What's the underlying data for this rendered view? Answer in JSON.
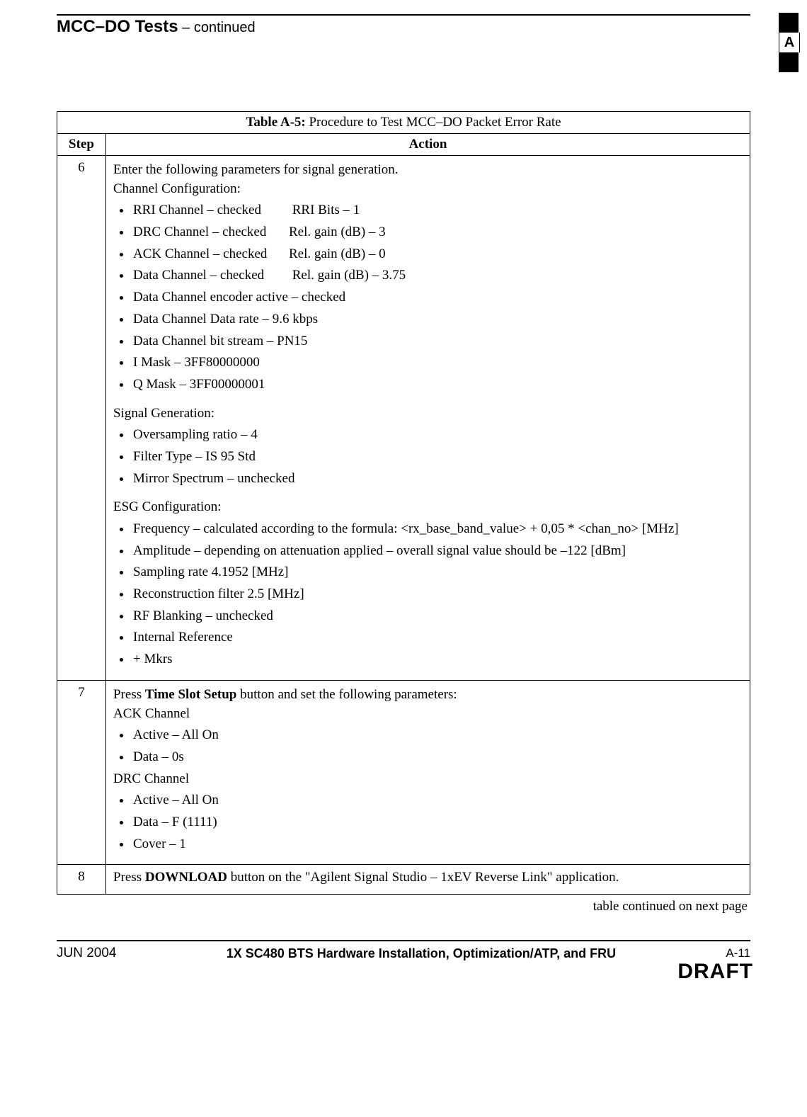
{
  "header": {
    "title": "MCC–DO Tests",
    "continued": " – continued",
    "tab_letter": "A"
  },
  "table": {
    "title_bold": "Table A-5:",
    "title_rest": " Procedure to Test MCC–DO Packet Error Rate",
    "step_head": "Step",
    "action_head": "Action",
    "rows": [
      {
        "step": "6",
        "intro": "Enter the following parameters for signal generation.",
        "group1_title": "Channel Configuration:",
        "group1_items": [
          {
            "a": "RRI Channel – checked",
            "b": "RRI Bits – 1"
          },
          {
            "a": "DRC Channel – checked",
            "b": "Rel. gain (dB) – 3"
          },
          {
            "a": "ACK Channel – checked",
            "b": "Rel. gain (dB) – 0"
          },
          {
            "a": "Data Channel – checked",
            "b": "Rel. gain (dB) – 3.75"
          },
          {
            "a": "Data Channel encoder active – checked"
          },
          {
            "a": "Data Channel Data rate – 9.6 kbps"
          },
          {
            "a": "Data Channel bit stream – PN15"
          },
          {
            "a": "I Mask  – 3FF80000000"
          },
          {
            "a": "Q Mask – 3FF00000001"
          }
        ],
        "group2_title": "Signal Generation:",
        "group2_items": [
          "Oversampling ratio – 4",
          "Filter Type – IS 95 Std",
          "Mirror Spectrum – unchecked"
        ],
        "group3_title": "ESG Configuration:",
        "group3_items": [
          "Frequency – calculated according to the formula: <rx_base_band_value> + 0,05 * <chan_no> [MHz]",
          "Amplitude – depending on attenuation applied – overall signal value should be –122 [dBm]",
          "Sampling rate 4.1952 [MHz]",
          "Reconstruction filter 2.5 [MHz]",
          "RF Blanking – unchecked",
          "Internal Reference",
          "+ Mkrs"
        ]
      },
      {
        "step": "7",
        "intro_pre": "Press ",
        "intro_bold": "Time Slot Setup",
        "intro_post": " button and set the following parameters:",
        "group1_title": "ACK Channel",
        "group1_items": [
          "Active – All On",
          "Data – 0s"
        ],
        "group2_title": "DRC Channel",
        "group2_items": [
          "Active – All On",
          "Data – F (1111)",
          "Cover – 1"
        ]
      },
      {
        "step": "8",
        "intro_pre": "Press ",
        "intro_bold": "DOWNLOAD",
        "intro_post": " button on the \"Agilent Signal Studio – 1xEV Reverse Link\" application."
      }
    ]
  },
  "continued_note": "table continued on next page",
  "footer": {
    "left": "JUN 2004",
    "center": "1X SC480 BTS Hardware Installation, Optimization/ATP, and FRU",
    "right": "A-11",
    "draft": "DRAFT"
  }
}
